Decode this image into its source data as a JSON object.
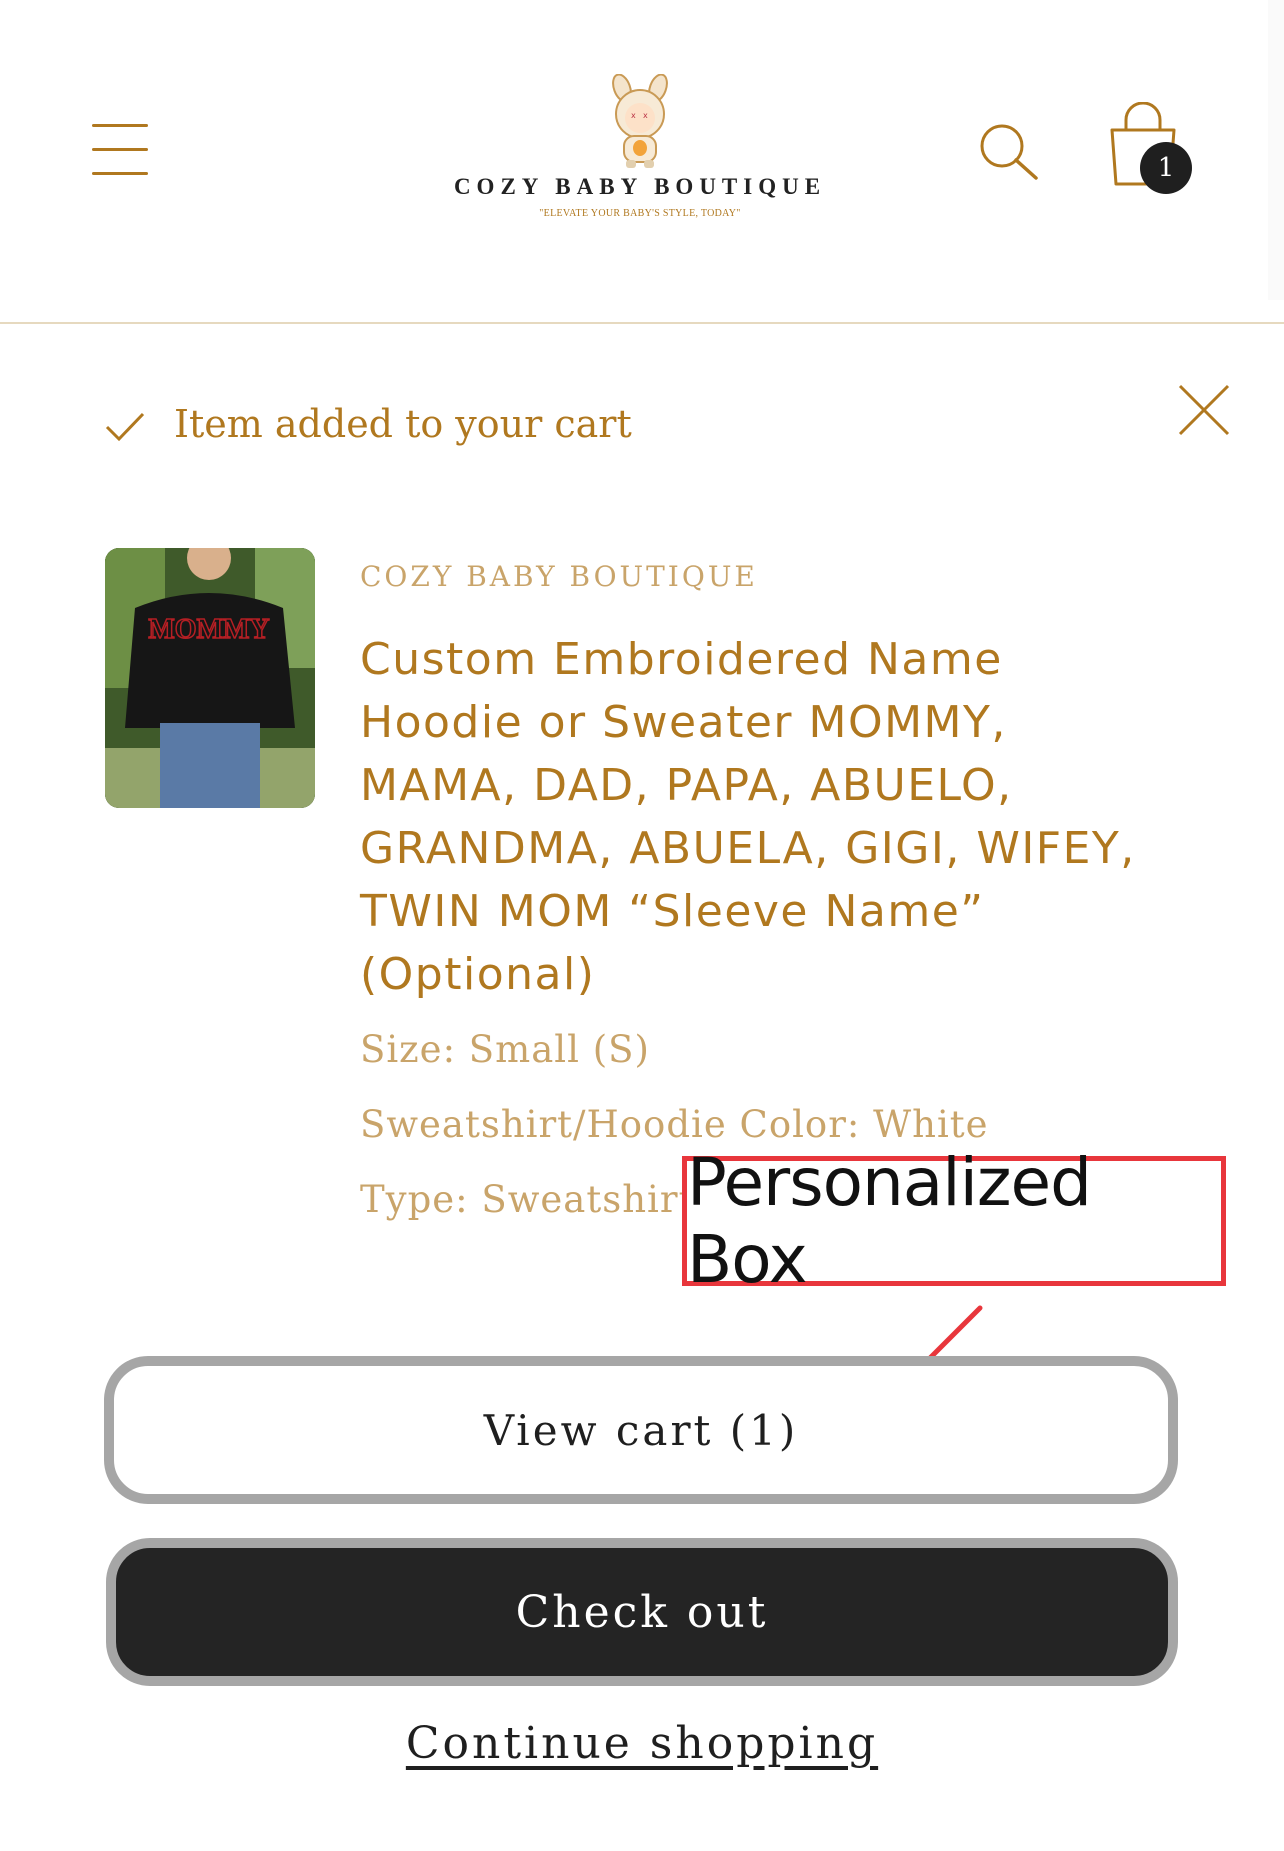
{
  "header": {
    "brand_name": "COZY BABY BOUTIQUE",
    "tagline": "\"ELEVATE YOUR BABY'S STYLE, TODAY\"",
    "cart_count": "1",
    "accent_color": "#b0781f"
  },
  "notification": {
    "message": "Item added to your cart"
  },
  "product": {
    "vendor": "COZY BABY BOUTIQUE",
    "title_lines": [
      "Custom Embroidered Name",
      "Hoodie or Sweater MOMMY,",
      "MAMA, DAD, PAPA, ABUELO,",
      "GRANDMA, ABUELA, GIGI, WIFEY,",
      "TWIN MOM “Sleeve Name”",
      "(Optional)"
    ],
    "thumbnail_text": "MOMMY",
    "options": [
      "Size: Small (S)",
      "Sweatshirt/Hoodie Color: White",
      "Type: Sweatshirt"
    ]
  },
  "annotation": {
    "label": "Personalized Box",
    "color": "#e8363c"
  },
  "actions": {
    "view_cart": "View cart (1)",
    "checkout": "Check out",
    "continue": "Continue shopping"
  },
  "icons": [
    "menu-icon",
    "search-icon",
    "cart-icon",
    "check-icon",
    "close-icon",
    "logo-icon"
  ]
}
